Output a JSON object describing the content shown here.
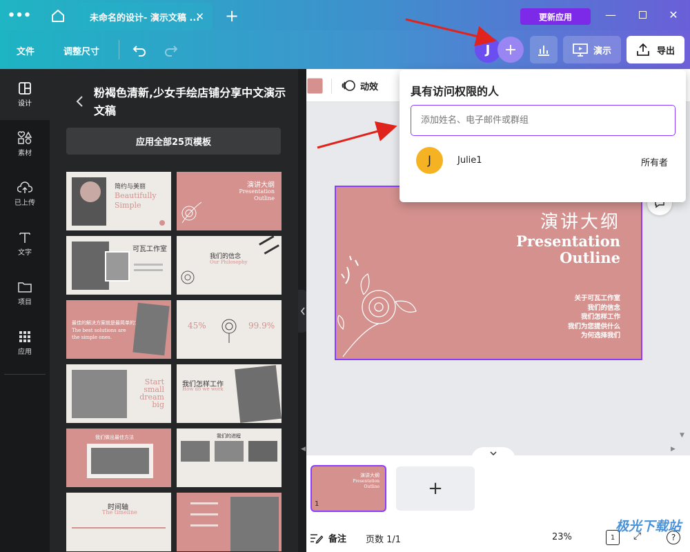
{
  "titlebar": {
    "tab_title": "未命名的设计- 演示文稿 ...",
    "update_label": "更新应用"
  },
  "toolbar": {
    "file": "文件",
    "resize": "调整尺寸",
    "avatar_initial": "J",
    "present": "演示",
    "export": "导出"
  },
  "rail": [
    {
      "label": "设计",
      "icon": "design-icon"
    },
    {
      "label": "素材",
      "icon": "elements-icon"
    },
    {
      "label": "已上传",
      "icon": "upload-icon"
    },
    {
      "label": "文字",
      "icon": "text-icon"
    },
    {
      "label": "项目",
      "icon": "folder-icon"
    },
    {
      "label": "应用",
      "icon": "apps-icon"
    }
  ],
  "panel": {
    "title": "粉褐色清新,少女手绘店铺分享中文演示文稿",
    "apply_all": "应用全部25页模板",
    "thumbs": [
      {
        "t1": "简约与美丽",
        "t2": "Beautifully",
        "t3": "Simple"
      },
      {
        "t1": "演讲大纲",
        "t2": "Presentation",
        "t3": "Outline"
      },
      {
        "t1": "可瓦工作室",
        "t2": "",
        "t3": ""
      },
      {
        "t1": "我们的信念",
        "t2": "Our Philosophy",
        "t3": ""
      },
      {
        "t1": "最佳的解决方案就是最简单的方法",
        "t2": "The best solutions are",
        "t3": "the simple ones."
      },
      {
        "t1": "45%",
        "t2": "99.9%",
        "t3": ""
      },
      {
        "t1": "Start",
        "t2": "small",
        "t3": "dream",
        "t4": "big"
      },
      {
        "t1": "我们怎样工作",
        "t2": "How do we work",
        "t3": ""
      },
      {
        "t1": "我们做出最佳方法",
        "t2": "",
        "t3": ""
      },
      {
        "t1": "我们的进程",
        "t2": "",
        "t3": ""
      },
      {
        "t1": "时间轴",
        "t2": "The timeline",
        "t3": ""
      },
      {
        "t1": "",
        "t2": "",
        "t3": ""
      }
    ]
  },
  "canvas_toolbar": {
    "animate": "动效",
    "color": "#d4918e"
  },
  "slide": {
    "title_cn": "演讲大纲",
    "title_en1": "Presentation",
    "title_en2": "Outline",
    "items": [
      "关于可瓦工作室",
      "我们的信念",
      "我们怎样工作",
      "我们为您提供什么",
      "为何选择我们"
    ]
  },
  "bottom": {
    "page_number": "1",
    "notes": "备注",
    "pages": "页数 1/1",
    "zoom": "23%"
  },
  "share_popup": {
    "title": "具有访问权限的人",
    "placeholder": "添加姓名、电子邮件或群组",
    "user_initial": "J",
    "user_name": "Julie1",
    "user_role": "所有者"
  },
  "watermark": "极光下载站"
}
